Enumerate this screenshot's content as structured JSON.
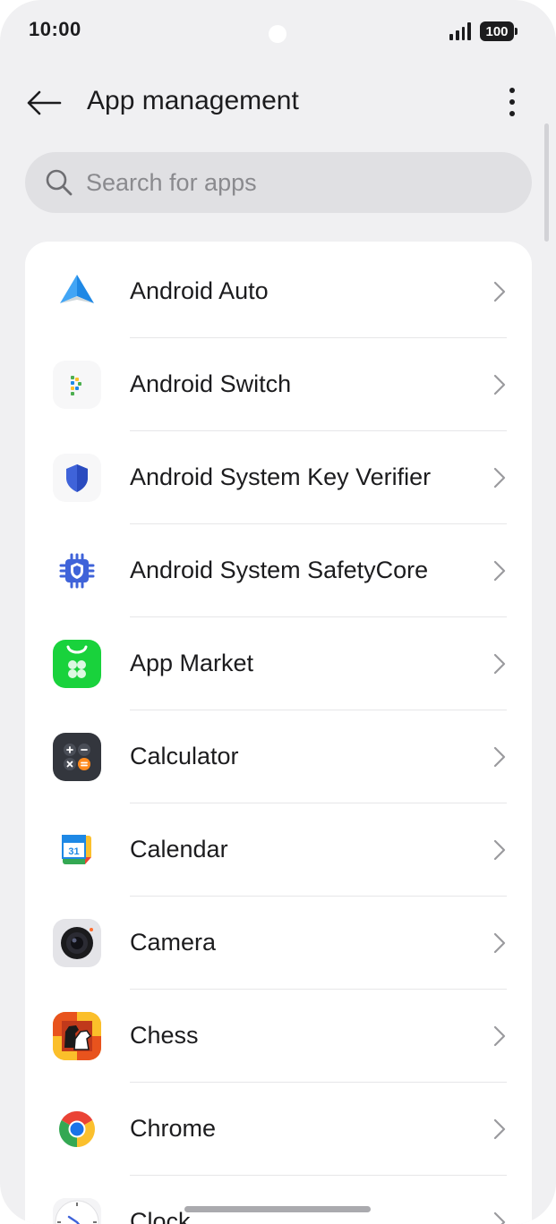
{
  "status_bar": {
    "time": "10:00",
    "battery": "100"
  },
  "header": {
    "title": "App management"
  },
  "search": {
    "placeholder": "Search for apps"
  },
  "apps": [
    {
      "name": "Android Auto",
      "icon": "android-auto-icon"
    },
    {
      "name": "Android Switch",
      "icon": "android-switch-icon"
    },
    {
      "name": "Android System Key Verifier",
      "icon": "key-verifier-icon"
    },
    {
      "name": "Android System SafetyCore",
      "icon": "safetycore-icon"
    },
    {
      "name": "App Market",
      "icon": "app-market-icon"
    },
    {
      "name": "Calculator",
      "icon": "calculator-icon"
    },
    {
      "name": "Calendar",
      "icon": "calendar-icon"
    },
    {
      "name": "Camera",
      "icon": "camera-icon"
    },
    {
      "name": "Chess",
      "icon": "chess-icon"
    },
    {
      "name": "Chrome",
      "icon": "chrome-icon"
    },
    {
      "name": "Clock",
      "icon": "clock-icon"
    }
  ],
  "calendar_day": "31",
  "colors": {
    "background": "#f0f0f2",
    "card": "#ffffff",
    "search_bg": "#e0e0e3",
    "chevron": "#9a9a9e"
  }
}
